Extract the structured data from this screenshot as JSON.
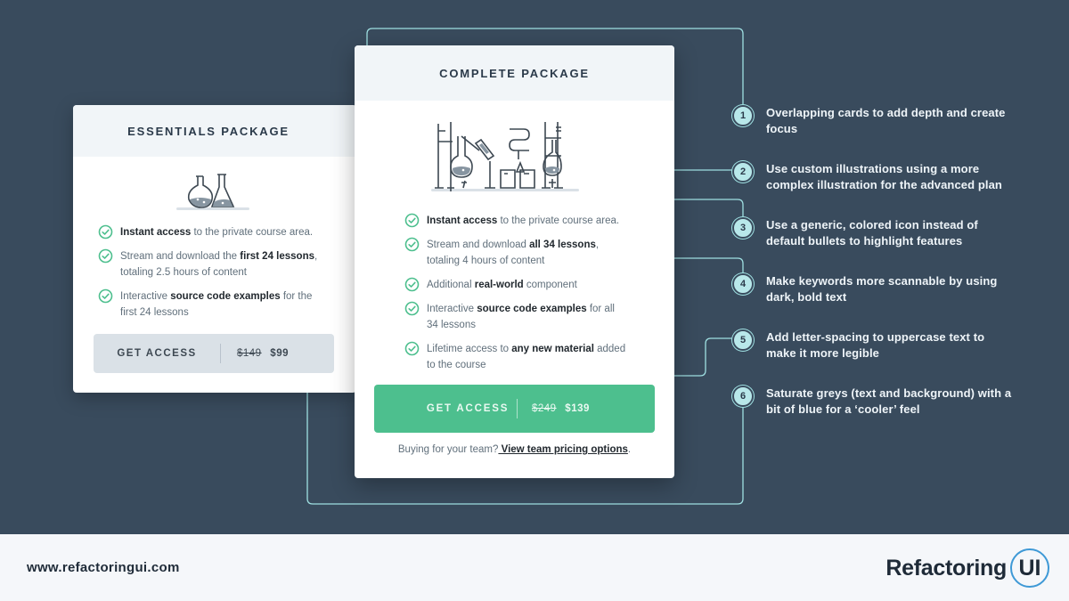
{
  "essentials": {
    "title": "ESSENTIALS PACKAGE",
    "features": [
      {
        "parts": [
          {
            "t": "Instant access",
            "b": true
          },
          {
            "t": " to the private course area.",
            "b": false
          }
        ]
      },
      {
        "parts": [
          {
            "t": "Stream and download the ",
            "b": false
          },
          {
            "t": "first 24 lessons",
            "b": true
          },
          {
            "t": ", totaling 2.5 hours of content",
            "b": false
          }
        ]
      },
      {
        "parts": [
          {
            "t": "Interactive ",
            "b": false
          },
          {
            "t": "source code examples",
            "b": true
          },
          {
            "t": " for the first 24 lessons",
            "b": false
          }
        ]
      }
    ],
    "button": {
      "label": "GET ACCESS",
      "old_price": "$149",
      "price": "$99"
    }
  },
  "complete": {
    "title": "COMPLETE PACKAGE",
    "features": [
      {
        "parts": [
          {
            "t": "Instant access",
            "b": true
          },
          {
            "t": " to the private course area.",
            "b": false
          }
        ]
      },
      {
        "parts": [
          {
            "t": "Stream and download ",
            "b": false
          },
          {
            "t": "all 34 lessons",
            "b": true
          },
          {
            "t": ", totaling 4 hours of content",
            "b": false
          }
        ]
      },
      {
        "parts": [
          {
            "t": "Additional ",
            "b": false
          },
          {
            "t": "real-world",
            "b": true
          },
          {
            "t": " component",
            "b": false
          }
        ]
      },
      {
        "parts": [
          {
            "t": "Interactive ",
            "b": false
          },
          {
            "t": "source code examples",
            "b": true
          },
          {
            "t": " for all 34 lessons",
            "b": false
          }
        ]
      },
      {
        "parts": [
          {
            "t": "Lifetime access to ",
            "b": false
          },
          {
            "t": "any new material",
            "b": true
          },
          {
            "t": " added to the course",
            "b": false
          }
        ]
      }
    ],
    "button": {
      "label": "GET ACCESS",
      "old_price": "$249",
      "price": "$139"
    },
    "team_text": "Buying for your team?",
    "team_link": " View team pricing options",
    "team_end": "."
  },
  "notes": [
    {
      "num": "1",
      "text": "Overlapping cards to add depth and create focus"
    },
    {
      "num": "2",
      "text": "Use custom illustrations using a more complex illustration for the advanced plan"
    },
    {
      "num": "3",
      "text": "Use a generic, colored icon instead of default bullets to highlight features"
    },
    {
      "num": "4",
      "text": "Make keywords more scannable by using dark, bold text"
    },
    {
      "num": "5",
      "text": "Add letter-spacing to uppercase text to make it more legible"
    },
    {
      "num": "6",
      "text": "Saturate greys (text and background) with a bit of blue for a ‘cooler’ feel"
    }
  ],
  "footer": {
    "site": "www.refactoringui.com",
    "logo_word": "Refactoring",
    "logo_ui": "UI"
  },
  "colors": {
    "background": "#394b5d",
    "accent_green": "#4dbf8e",
    "connector_teal": "#9fe0e2",
    "logo_blue": "#3e99d6"
  },
  "icons": [
    "check-circle-icon",
    "flask-illustration",
    "lab-equipment-illustration"
  ]
}
